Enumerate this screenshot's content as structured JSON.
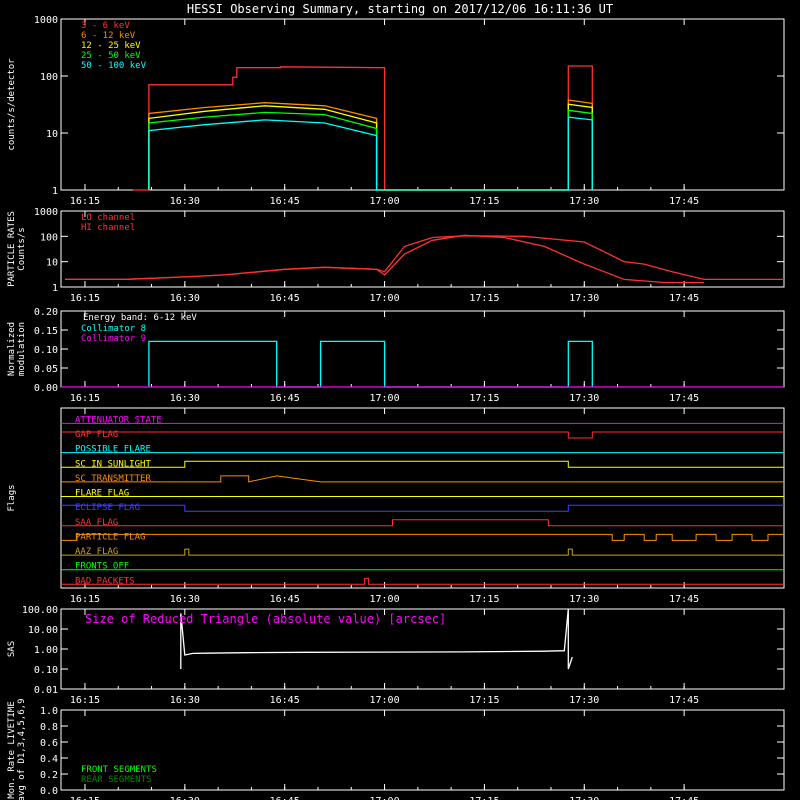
{
  "title": "HESSI Observing Summary, starting on 2017/12/06 16:11:36 UT",
  "time_ticks": [
    "16:15",
    "16:30",
    "16:45",
    "17:00",
    "17:15",
    "17:30",
    "17:45"
  ],
  "colors": {
    "bg": "#000000",
    "axis": "#ffffff"
  },
  "chart_data": [
    {
      "id": "lightcurve",
      "type": "line",
      "ylabel": "counts/s/detector",
      "yscale": "log",
      "ylim": [
        1,
        1000
      ],
      "yticks": [
        "1",
        "10",
        "100",
        "1000"
      ],
      "legend_position": "top-left",
      "series": [
        {
          "name": "3 - 6 keV",
          "color": "#ff3030",
          "x": [
            16.37,
            16.41,
            16.41,
            16.62,
            16.62,
            16.63,
            16.63,
            16.74,
            16.74,
            17.0,
            17.0,
            17.46,
            17.46,
            17.52,
            17.52
          ],
          "y": [
            1,
            1,
            70,
            70,
            95,
            95,
            140,
            140,
            145,
            140,
            1,
            1,
            150,
            150,
            1
          ]
        },
        {
          "name": "6 - 12 keV",
          "color": "#ff8c00",
          "x": [
            16.41,
            16.41,
            16.55,
            16.7,
            16.85,
            16.98,
            16.98,
            17.46,
            17.46,
            17.52,
            17.52
          ],
          "y": [
            1,
            22,
            28,
            34,
            30,
            18,
            1,
            1,
            38,
            33,
            1
          ]
        },
        {
          "name": "12 - 25 keV",
          "color": "#ffff00",
          "x": [
            16.41,
            16.41,
            16.55,
            16.7,
            16.85,
            16.98,
            16.98,
            17.46,
            17.46,
            17.52,
            17.52
          ],
          "y": [
            1,
            18,
            24,
            30,
            26,
            15,
            1,
            1,
            32,
            28,
            1
          ]
        },
        {
          "name": "25 - 50 keV",
          "color": "#00ff00",
          "x": [
            16.41,
            16.41,
            16.55,
            16.7,
            16.85,
            16.98,
            16.98,
            17.46,
            17.46,
            17.52,
            17.52
          ],
          "y": [
            1,
            15,
            19,
            23,
            21,
            12,
            1,
            1,
            25,
            22,
            1
          ]
        },
        {
          "name": "50 - 100 keV",
          "color": "#00ffff",
          "x": [
            16.41,
            16.41,
            16.55,
            16.7,
            16.85,
            16.98,
            16.98,
            17.46,
            17.46,
            17.52,
            17.52
          ],
          "y": [
            1,
            11,
            14,
            17,
            15,
            9,
            1,
            1,
            19,
            17,
            1
          ]
        }
      ]
    },
    {
      "id": "particles",
      "type": "line",
      "ylabel_lines": [
        "PARTICLE RATES",
        "Counts/s"
      ],
      "yscale": "log",
      "ylim": [
        1,
        1000
      ],
      "yticks": [
        "1",
        "10",
        "100",
        "1000"
      ],
      "legend_position": "top-left",
      "series": [
        {
          "name": "LO channel",
          "color": "#ff3030",
          "x": [
            16.2,
            16.35,
            16.5,
            16.6,
            16.75,
            16.85,
            16.98,
            17.0,
            17.05,
            17.12,
            17.2,
            17.3,
            17.4,
            17.5,
            17.55,
            17.6,
            17.7,
            17.78,
            17.8
          ],
          "y": [
            2,
            2,
            2.5,
            3,
            5,
            6,
            5,
            3,
            20,
            70,
            110,
            90,
            40,
            8,
            4,
            2,
            1.5,
            1.5,
            1.5
          ]
        },
        {
          "name": "HI channel",
          "color": "#ff3030",
          "x": [
            16.2,
            16.35,
            16.5,
            16.6,
            16.75,
            16.85,
            16.98,
            17.0,
            17.05,
            17.12,
            17.2,
            17.35,
            17.5,
            17.6,
            17.65,
            17.72,
            17.8,
            17.88,
            18.0
          ],
          "y": [
            2,
            2,
            2.5,
            3,
            5,
            6,
            5,
            4,
            40,
            90,
            105,
            100,
            60,
            10,
            8,
            4,
            2,
            2,
            2
          ]
        }
      ]
    },
    {
      "id": "modulation",
      "type": "line",
      "ylabel_lines": [
        "Normalized",
        "modulation"
      ],
      "ylim": [
        0,
        0.2
      ],
      "yticks": [
        "0.00",
        "0.05",
        "0.10",
        "0.15",
        "0.20"
      ],
      "legend_title": "Energy band: 6-12 keV",
      "legend_position": "top-left",
      "series": [
        {
          "name": "Collimator 8",
          "color": "#00ffff",
          "x": [
            16.41,
            16.41,
            16.73,
            16.73,
            16.84,
            16.84,
            17.0,
            17.0,
            17.46,
            17.46,
            17.52,
            17.52
          ],
          "y": [
            0,
            0.12,
            0.12,
            0,
            0,
            0.12,
            0.12,
            0,
            0,
            0.12,
            0.12,
            0
          ]
        },
        {
          "name": "Collimator 9",
          "color": "#ff00ff",
          "x": [
            16.19,
            18.0
          ],
          "y": [
            0,
            0
          ]
        }
      ]
    },
    {
      "id": "flags",
      "type": "line",
      "ylabel": "Flags",
      "flags": [
        {
          "name": "ATTENUATOR STATE",
          "color": "#ff00ff",
          "x": [
            16.19,
            18.0
          ],
          "y": [
            0,
            0
          ]
        },
        {
          "name": "GAP FLAG",
          "color": "#ff3030",
          "x": [
            16.19,
            17.46,
            17.46,
            17.52,
            17.52,
            18.0
          ],
          "y": [
            1,
            1,
            0,
            0,
            1,
            1
          ]
        },
        {
          "name": "POSSIBLE FLARE",
          "color": "#00ffff",
          "x": [
            16.19,
            18.0
          ],
          "y": [
            0,
            0
          ]
        },
        {
          "name": "SC IN SUNLIGHT",
          "color": "#ffff00",
          "x": [
            16.19,
            16.5,
            16.5,
            17.46,
            17.46,
            18.0
          ],
          "y": [
            0,
            0,
            1,
            1,
            0,
            0
          ]
        },
        {
          "name": "SC TRANSMITTER",
          "color": "#ff8c00",
          "x": [
            16.19,
            16.59,
            16.59,
            16.66,
            16.66,
            16.73,
            16.73,
            16.84,
            16.84,
            18.0
          ],
          "y": [
            0,
            0,
            1,
            1,
            0,
            1,
            1,
            0,
            0,
            0
          ]
        },
        {
          "name": "FLARE FLAG",
          "color": "#ffff00",
          "x": [
            16.19,
            18.0
          ],
          "y": [
            0,
            0
          ]
        },
        {
          "name": "ECLIPSE FLAG",
          "color": "#4040ff",
          "x": [
            16.19,
            16.5,
            16.5,
            17.46,
            17.46,
            18.0
          ],
          "y": [
            1,
            1,
            0,
            0,
            1,
            1
          ]
        },
        {
          "name": "SAA FLAG",
          "color": "#ff3030",
          "x": [
            16.19,
            17.02,
            17.02,
            17.41,
            17.41,
            18.0
          ],
          "y": [
            0,
            0,
            1,
            1,
            0,
            0
          ]
        },
        {
          "name": "PARTICLE FLAG",
          "color": "#ff8c00",
          "x": [
            16.19,
            16.23,
            16.23,
            17.57,
            17.57,
            17.6,
            17.6,
            17.65,
            17.65,
            17.68,
            17.68,
            17.72,
            17.72,
            17.78,
            17.78,
            17.83,
            17.83,
            17.87,
            17.87,
            17.92,
            17.92,
            17.96,
            17.96,
            18.0
          ],
          "y": [
            0,
            0,
            1,
            1,
            0,
            0,
            1,
            1,
            0,
            0,
            1,
            1,
            0,
            0,
            1,
            1,
            0,
            0,
            1,
            1,
            0,
            0,
            1,
            1
          ]
        },
        {
          "name": "AAZ FLAG",
          "color": "#c8a020",
          "x": [
            16.19,
            16.5,
            16.5,
            16.51,
            16.51,
            17.46,
            17.46,
            17.47,
            17.47,
            18.0
          ],
          "y": [
            0,
            0,
            1,
            1,
            0,
            0,
            1,
            1,
            0,
            0
          ]
        },
        {
          "name": "FRONTS OFF",
          "color": "#00ff00",
          "x": [
            16.19,
            18.0
          ],
          "y": [
            0,
            0
          ]
        },
        {
          "name": "BAD PACKETS",
          "color": "#ff3030",
          "x": [
            16.19,
            16.95,
            16.95,
            16.96,
            16.96,
            18.0
          ],
          "y": [
            0,
            0,
            1,
            1,
            0,
            0
          ]
        }
      ]
    },
    {
      "id": "sas",
      "type": "line",
      "ylabel": "SAS",
      "yscale": "log",
      "ylim": [
        0.01,
        100
      ],
      "yticks": [
        "0.01",
        "0.10",
        "1.00",
        "10.00",
        "100.00"
      ],
      "annotation": "Size of Reduced Triangle (absolute value) [arcsec]",
      "series": [
        {
          "name": "",
          "color": "#ffffff",
          "x": [
            16.49,
            16.49,
            16.5,
            16.52,
            16.55,
            16.65,
            16.8,
            17.0,
            17.2,
            17.4,
            17.45,
            17.46,
            17.46,
            17.47
          ],
          "y": [
            0.1,
            60,
            0.5,
            0.6,
            0.62,
            0.65,
            0.68,
            0.7,
            0.72,
            0.78,
            0.82,
            100,
            0.1,
            0.4
          ]
        }
      ]
    },
    {
      "id": "livetime",
      "type": "line",
      "ylabel_lines": [
        "Mon. Rate LIVETIME",
        "avg of D1,3,4,5,6,9"
      ],
      "ylim": [
        0,
        1.0
      ],
      "yticks": [
        "0.0",
        "0.2",
        "0.4",
        "0.6",
        "0.8",
        "1.0"
      ],
      "legend_position": "bottom-left",
      "series": [
        {
          "name": "FRONT SEGMENTS",
          "color": "#00ff00",
          "x": [],
          "y": []
        },
        {
          "name": "REAR SEGMENTS",
          "color": "#008800",
          "x": [],
          "y": []
        }
      ]
    }
  ]
}
